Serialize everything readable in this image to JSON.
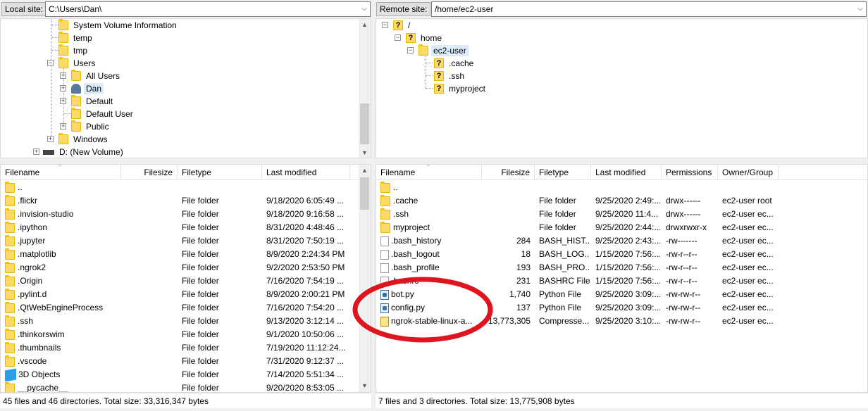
{
  "local": {
    "site_label": "Local site:",
    "site_path": "C:\\Users\\Dan\\",
    "tree": [
      {
        "label": "System Volume Information",
        "icon": "folder",
        "level": 2
      },
      {
        "label": "temp",
        "icon": "folder",
        "level": 2
      },
      {
        "label": "tmp",
        "icon": "folder",
        "level": 2
      },
      {
        "label": "Users",
        "icon": "folder",
        "level": 2,
        "expanded": true
      },
      {
        "label": "All Users",
        "icon": "folder",
        "level": 3,
        "expandable": true
      },
      {
        "label": "Dan",
        "icon": "user",
        "level": 3,
        "expandable": true,
        "selected": true
      },
      {
        "label": "Default",
        "icon": "folder",
        "level": 3,
        "expandable": true
      },
      {
        "label": "Default User",
        "icon": "folder",
        "level": 3
      },
      {
        "label": "Public",
        "icon": "folder",
        "level": 3,
        "expandable": true
      },
      {
        "label": "Windows",
        "icon": "folder",
        "level": 2,
        "expandable": true
      },
      {
        "label": "D: (New Volume)",
        "icon": "drive",
        "level": 1,
        "expandable": true
      }
    ],
    "columns": [
      "Filename",
      "Filesize",
      "Filetype",
      "Last modified"
    ],
    "files": [
      {
        "name": "..",
        "size": "",
        "type": "",
        "modified": "",
        "icon": "folder"
      },
      {
        "name": ".flickr",
        "size": "",
        "type": "File folder",
        "modified": "9/18/2020 6:05:49 ...",
        "icon": "folder"
      },
      {
        "name": ".invision-studio",
        "size": "",
        "type": "File folder",
        "modified": "9/18/2020 9:16:58 ...",
        "icon": "folder"
      },
      {
        "name": ".ipython",
        "size": "",
        "type": "File folder",
        "modified": "8/31/2020 4:48:46 ...",
        "icon": "folder"
      },
      {
        "name": ".jupyter",
        "size": "",
        "type": "File folder",
        "modified": "8/31/2020 7:50:19 ...",
        "icon": "folder"
      },
      {
        "name": ".matplotlib",
        "size": "",
        "type": "File folder",
        "modified": "8/9/2020 2:24:34 PM",
        "icon": "folder"
      },
      {
        "name": ".ngrok2",
        "size": "",
        "type": "File folder",
        "modified": "9/2/2020 2:53:50 PM",
        "icon": "folder"
      },
      {
        "name": ".Origin",
        "size": "",
        "type": "File folder",
        "modified": "7/16/2020 7:54:19 ...",
        "icon": "folder"
      },
      {
        "name": ".pylint.d",
        "size": "",
        "type": "File folder",
        "modified": "8/9/2020 2:00:21 PM",
        "icon": "folder"
      },
      {
        "name": ".QtWebEngineProcess",
        "size": "",
        "type": "File folder",
        "modified": "7/16/2020 7:54:20 ...",
        "icon": "folder"
      },
      {
        "name": ".ssh",
        "size": "",
        "type": "File folder",
        "modified": "9/13/2020 3:12:14 ...",
        "icon": "folder"
      },
      {
        "name": ".thinkorswim",
        "size": "",
        "type": "File folder",
        "modified": "9/1/2020 10:50:06 ...",
        "icon": "folder"
      },
      {
        "name": ".thumbnails",
        "size": "",
        "type": "File folder",
        "modified": "7/19/2020 11:12:24...",
        "icon": "folder"
      },
      {
        "name": ".vscode",
        "size": "",
        "type": "File folder",
        "modified": "7/31/2020 9:12:37 ...",
        "icon": "folder"
      },
      {
        "name": "3D Objects",
        "size": "",
        "type": "File folder",
        "modified": "7/14/2020 5:51:34 ...",
        "icon": "cube"
      },
      {
        "name": "__pycache__",
        "size": "",
        "type": "File folder",
        "modified": "9/20/2020 8:53:05 ...",
        "icon": "folder"
      }
    ],
    "status": "45 files and 46 directories. Total size: 33,316,347 bytes"
  },
  "remote": {
    "site_label": "Remote site:",
    "site_path": "/home/ec2-user",
    "tree": [
      {
        "label": "/",
        "icon": "qfolder",
        "level": 0,
        "expanded": true
      },
      {
        "label": "home",
        "icon": "qfolder",
        "level": 1,
        "expanded": true
      },
      {
        "label": "ec2-user",
        "icon": "folder",
        "level": 2,
        "expanded": true,
        "selected": true
      },
      {
        "label": ".cache",
        "icon": "qfolder",
        "level": 3
      },
      {
        "label": ".ssh",
        "icon": "qfolder",
        "level": 3
      },
      {
        "label": "myproject",
        "icon": "qfolder",
        "level": 3
      }
    ],
    "columns": [
      "Filename",
      "Filesize",
      "Filetype",
      "Last modified",
      "Permissions",
      "Owner/Group"
    ],
    "files": [
      {
        "name": "..",
        "size": "",
        "type": "",
        "modified": "",
        "perms": "",
        "owner": "",
        "icon": "folder"
      },
      {
        "name": ".cache",
        "size": "",
        "type": "File folder",
        "modified": "9/25/2020 2:49:...",
        "perms": "drwx------",
        "owner": "ec2-user root",
        "icon": "folder"
      },
      {
        "name": ".ssh",
        "size": "",
        "type": "File folder",
        "modified": "9/25/2020 11:4...",
        "perms": "drwx------",
        "owner": "ec2-user ec...",
        "icon": "folder"
      },
      {
        "name": "myproject",
        "size": "",
        "type": "File folder",
        "modified": "9/25/2020 2:44:...",
        "perms": "drwxrwxr-x",
        "owner": "ec2-user ec...",
        "icon": "folder"
      },
      {
        "name": ".bash_history",
        "size": "284",
        "type": "BASH_HIST...",
        "modified": "9/25/2020 2:43:...",
        "perms": "-rw-------",
        "owner": "ec2-user ec...",
        "icon": "file"
      },
      {
        "name": ".bash_logout",
        "size": "18",
        "type": "BASH_LOG...",
        "modified": "1/15/2020 7:56:...",
        "perms": "-rw-r--r--",
        "owner": "ec2-user ec...",
        "icon": "file"
      },
      {
        "name": ".bash_profile",
        "size": "193",
        "type": "BASH_PRO...",
        "modified": "1/15/2020 7:56:...",
        "perms": "-rw-r--r--",
        "owner": "ec2-user ec...",
        "icon": "file"
      },
      {
        "name": ".bashrc",
        "size": "231",
        "type": "BASHRC File",
        "modified": "1/15/2020 7:56:...",
        "perms": "-rw-r--r--",
        "owner": "ec2-user ec...",
        "icon": "file"
      },
      {
        "name": "bot.py",
        "size": "1,740",
        "type": "Python File",
        "modified": "9/25/2020 3:09:...",
        "perms": "-rw-rw-r--",
        "owner": "ec2-user ec...",
        "icon": "python"
      },
      {
        "name": "config.py",
        "size": "137",
        "type": "Python File",
        "modified": "9/25/2020 3:09:...",
        "perms": "-rw-rw-r--",
        "owner": "ec2-user ec...",
        "icon": "python"
      },
      {
        "name": "ngrok-stable-linux-a...",
        "size": "13,773,305",
        "type": "Compresse...",
        "modified": "9/25/2020 3:10:...",
        "perms": "-rw-rw-r--",
        "owner": "ec2-user ec...",
        "icon": "zip"
      }
    ],
    "status": "7 files and 3 directories. Total size: 13,775,908 bytes"
  },
  "annotation": {
    "shape": "ellipse",
    "color": "#e0141e"
  }
}
